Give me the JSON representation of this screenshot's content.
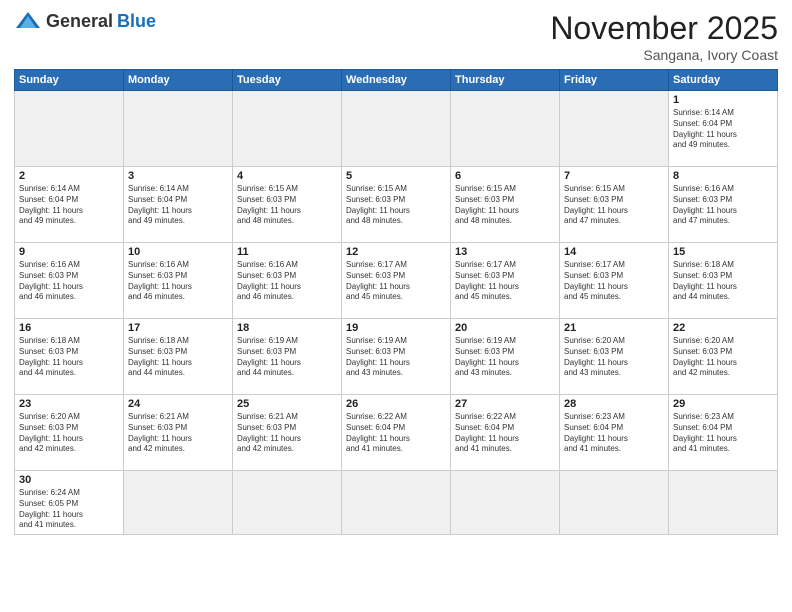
{
  "logo": {
    "general": "General",
    "blue": "Blue"
  },
  "header": {
    "month": "November 2025",
    "location": "Sangana, Ivory Coast"
  },
  "weekdays": [
    "Sunday",
    "Monday",
    "Tuesday",
    "Wednesday",
    "Thursday",
    "Friday",
    "Saturday"
  ],
  "weeks": [
    [
      {
        "day": null,
        "info": ""
      },
      {
        "day": null,
        "info": ""
      },
      {
        "day": null,
        "info": ""
      },
      {
        "day": null,
        "info": ""
      },
      {
        "day": null,
        "info": ""
      },
      {
        "day": null,
        "info": ""
      },
      {
        "day": "1",
        "info": "Sunrise: 6:14 AM\nSunset: 6:04 PM\nDaylight: 11 hours\nand 49 minutes."
      }
    ],
    [
      {
        "day": "2",
        "info": "Sunrise: 6:14 AM\nSunset: 6:04 PM\nDaylight: 11 hours\nand 49 minutes."
      },
      {
        "day": "3",
        "info": "Sunrise: 6:14 AM\nSunset: 6:04 PM\nDaylight: 11 hours\nand 49 minutes."
      },
      {
        "day": "4",
        "info": "Sunrise: 6:15 AM\nSunset: 6:03 PM\nDaylight: 11 hours\nand 48 minutes."
      },
      {
        "day": "5",
        "info": "Sunrise: 6:15 AM\nSunset: 6:03 PM\nDaylight: 11 hours\nand 48 minutes."
      },
      {
        "day": "6",
        "info": "Sunrise: 6:15 AM\nSunset: 6:03 PM\nDaylight: 11 hours\nand 48 minutes."
      },
      {
        "day": "7",
        "info": "Sunrise: 6:15 AM\nSunset: 6:03 PM\nDaylight: 11 hours\nand 47 minutes."
      },
      {
        "day": "8",
        "info": "Sunrise: 6:16 AM\nSunset: 6:03 PM\nDaylight: 11 hours\nand 47 minutes."
      }
    ],
    [
      {
        "day": "9",
        "info": "Sunrise: 6:16 AM\nSunset: 6:03 PM\nDaylight: 11 hours\nand 46 minutes."
      },
      {
        "day": "10",
        "info": "Sunrise: 6:16 AM\nSunset: 6:03 PM\nDaylight: 11 hours\nand 46 minutes."
      },
      {
        "day": "11",
        "info": "Sunrise: 6:16 AM\nSunset: 6:03 PM\nDaylight: 11 hours\nand 46 minutes."
      },
      {
        "day": "12",
        "info": "Sunrise: 6:17 AM\nSunset: 6:03 PM\nDaylight: 11 hours\nand 45 minutes."
      },
      {
        "day": "13",
        "info": "Sunrise: 6:17 AM\nSunset: 6:03 PM\nDaylight: 11 hours\nand 45 minutes."
      },
      {
        "day": "14",
        "info": "Sunrise: 6:17 AM\nSunset: 6:03 PM\nDaylight: 11 hours\nand 45 minutes."
      },
      {
        "day": "15",
        "info": "Sunrise: 6:18 AM\nSunset: 6:03 PM\nDaylight: 11 hours\nand 44 minutes."
      }
    ],
    [
      {
        "day": "16",
        "info": "Sunrise: 6:18 AM\nSunset: 6:03 PM\nDaylight: 11 hours\nand 44 minutes."
      },
      {
        "day": "17",
        "info": "Sunrise: 6:18 AM\nSunset: 6:03 PM\nDaylight: 11 hours\nand 44 minutes."
      },
      {
        "day": "18",
        "info": "Sunrise: 6:19 AM\nSunset: 6:03 PM\nDaylight: 11 hours\nand 44 minutes."
      },
      {
        "day": "19",
        "info": "Sunrise: 6:19 AM\nSunset: 6:03 PM\nDaylight: 11 hours\nand 43 minutes."
      },
      {
        "day": "20",
        "info": "Sunrise: 6:19 AM\nSunset: 6:03 PM\nDaylight: 11 hours\nand 43 minutes."
      },
      {
        "day": "21",
        "info": "Sunrise: 6:20 AM\nSunset: 6:03 PM\nDaylight: 11 hours\nand 43 minutes."
      },
      {
        "day": "22",
        "info": "Sunrise: 6:20 AM\nSunset: 6:03 PM\nDaylight: 11 hours\nand 42 minutes."
      }
    ],
    [
      {
        "day": "23",
        "info": "Sunrise: 6:20 AM\nSunset: 6:03 PM\nDaylight: 11 hours\nand 42 minutes."
      },
      {
        "day": "24",
        "info": "Sunrise: 6:21 AM\nSunset: 6:03 PM\nDaylight: 11 hours\nand 42 minutes."
      },
      {
        "day": "25",
        "info": "Sunrise: 6:21 AM\nSunset: 6:03 PM\nDaylight: 11 hours\nand 42 minutes."
      },
      {
        "day": "26",
        "info": "Sunrise: 6:22 AM\nSunset: 6:04 PM\nDaylight: 11 hours\nand 41 minutes."
      },
      {
        "day": "27",
        "info": "Sunrise: 6:22 AM\nSunset: 6:04 PM\nDaylight: 11 hours\nand 41 minutes."
      },
      {
        "day": "28",
        "info": "Sunrise: 6:23 AM\nSunset: 6:04 PM\nDaylight: 11 hours\nand 41 minutes."
      },
      {
        "day": "29",
        "info": "Sunrise: 6:23 AM\nSunset: 6:04 PM\nDaylight: 11 hours\nand 41 minutes."
      }
    ],
    [
      {
        "day": "30",
        "info": "Sunrise: 6:24 AM\nSunset: 6:05 PM\nDaylight: 11 hours\nand 41 minutes.",
        "last": true
      },
      {
        "day": null,
        "info": "",
        "last": true
      },
      {
        "day": null,
        "info": "",
        "last": true
      },
      {
        "day": null,
        "info": "",
        "last": true
      },
      {
        "day": null,
        "info": "",
        "last": true
      },
      {
        "day": null,
        "info": "",
        "last": true
      },
      {
        "day": null,
        "info": "",
        "last": true
      }
    ]
  ]
}
